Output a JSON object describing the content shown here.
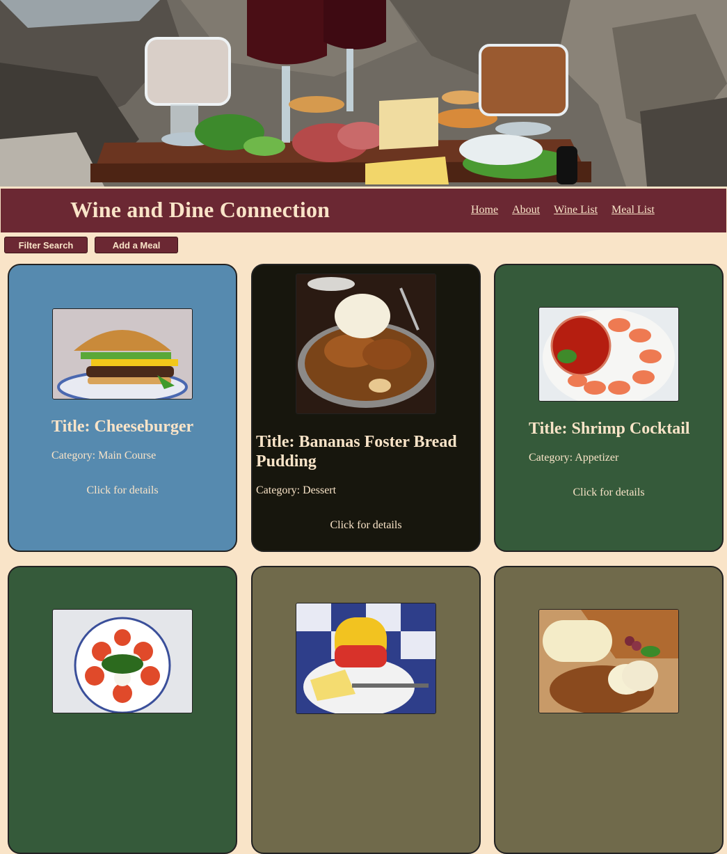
{
  "header": {
    "title": "Wine and Dine Connection",
    "nav": [
      "Home",
      "About",
      "Wine List",
      "Meal List"
    ]
  },
  "toolbar": {
    "filter_label": "Filter Search",
    "add_label": "Add a Meal"
  },
  "cards": [
    {
      "title": "Title: Cheeseburger",
      "category": "Category: Main Course",
      "details": "Click for details",
      "color": "#568aaf"
    },
    {
      "title": "Title: Bananas Foster Bread Pudding",
      "category": "Category: Dessert",
      "details": "Click for details",
      "color": "#17160d"
    },
    {
      "title": "Title: Shrimp Cocktail",
      "category": "Category: Appetizer",
      "details": "Click for details",
      "color": "#355a3a"
    },
    {
      "color": "#355a3a"
    },
    {
      "color": "#706a4b"
    },
    {
      "color": "#706a4b"
    }
  ],
  "colors": {
    "page_background": "#f9e4c8",
    "header_background": "#6b2833",
    "text_light": "#f9e4c8"
  },
  "images": {
    "hero": "wine-charcuterie-on-rocks-photo",
    "card_1": "cheeseburger-photo",
    "card_2": "bread-pudding-photo",
    "card_3": "shrimp-cocktail-photo",
    "card_4": "caprese-salad-photo",
    "card_5": "gouda-cheese-photo",
    "card_6": "provolone-cheese-photo"
  }
}
